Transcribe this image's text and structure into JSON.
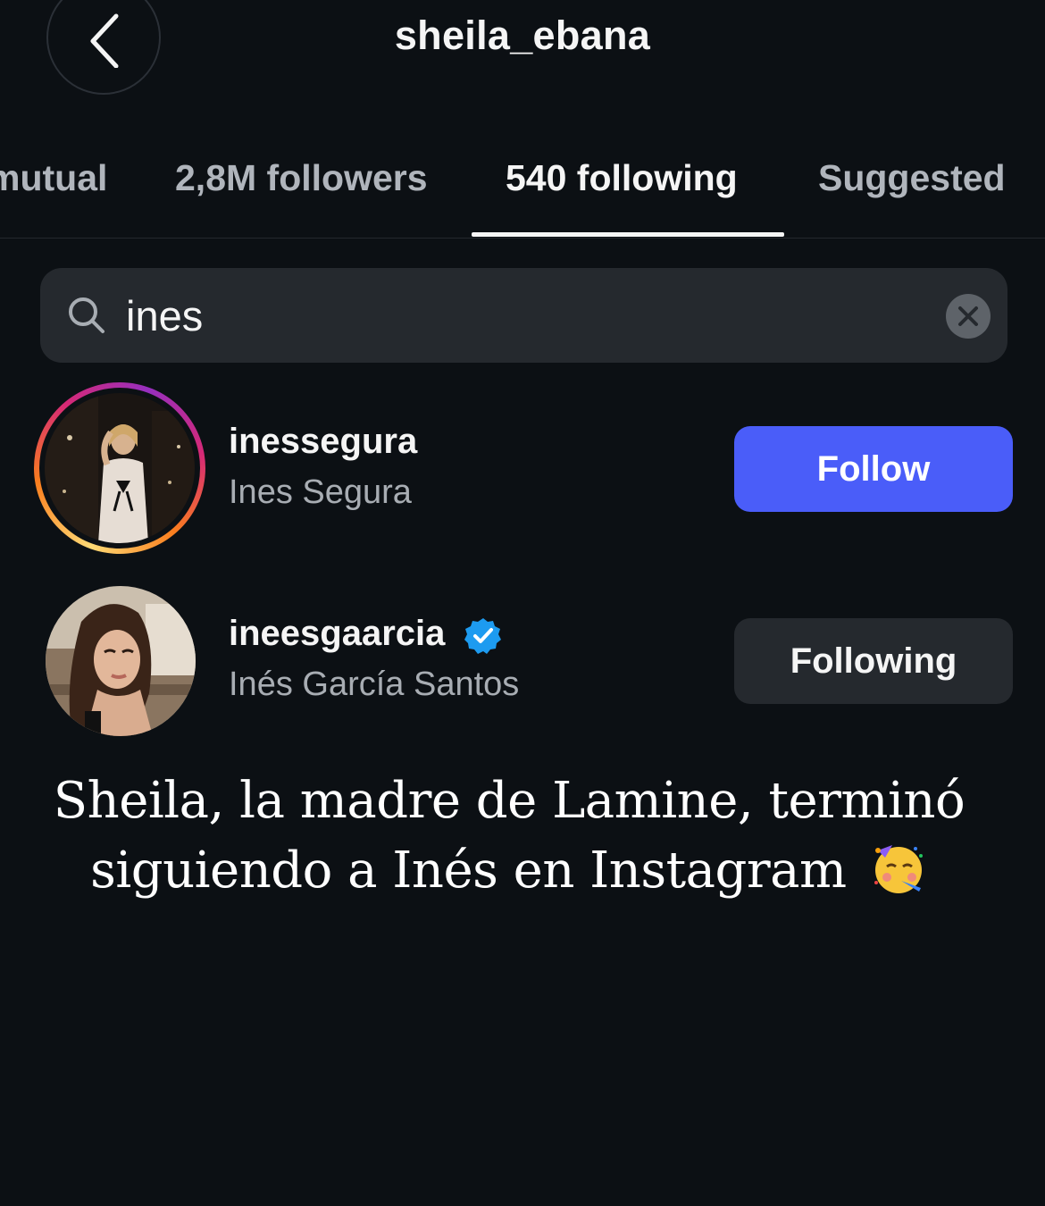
{
  "header": {
    "title": "sheila_ebana",
    "back_icon": "chevron-left-icon"
  },
  "tabs": [
    {
      "label": "mutual",
      "active": false
    },
    {
      "label": "2,8M followers",
      "active": false
    },
    {
      "label": "540 following",
      "active": true
    },
    {
      "label": "Suggested",
      "active": false
    }
  ],
  "search": {
    "value": "ines",
    "icon": "search-icon",
    "clear_icon": "close-icon"
  },
  "results": [
    {
      "username": "inessegura",
      "full_name": "Ines Segura",
      "verified": false,
      "has_story": true,
      "button_label": "Follow"
    },
    {
      "username": "ineesgaarcia",
      "full_name": "Inés García Santos",
      "verified": true,
      "has_story": false,
      "button_label": "Following"
    }
  ],
  "caption": {
    "line1": "Sheila, la madre de Lamine, terminó",
    "line2": "siguiendo a Inés en Instagram",
    "emoji": "partying-face-emoji"
  },
  "colors": {
    "background": "#0c1014",
    "follow_button": "#4a5df9",
    "following_button": "#25292e",
    "verified_badge": "#1d9bf0"
  }
}
